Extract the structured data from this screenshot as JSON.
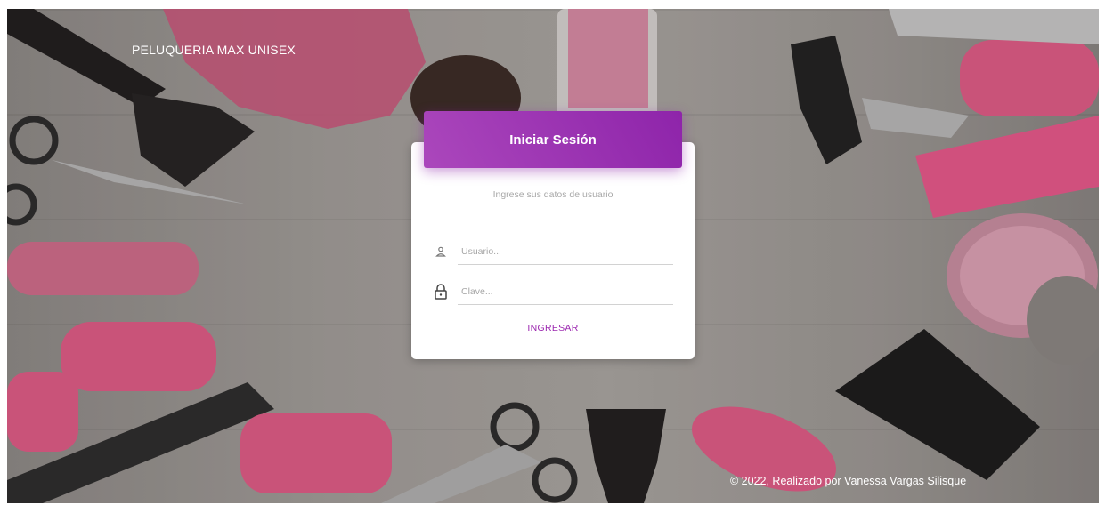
{
  "brand": {
    "title": "PELUQUERIA MAX UNISEX"
  },
  "login": {
    "title": "Iniciar Sesión",
    "subtitle": "Ingrese sus datos de usuario",
    "username": {
      "placeholder": "Usuario...",
      "icon": "user-icon"
    },
    "password": {
      "placeholder": "Clave...",
      "icon": "lock-icon"
    },
    "submit_label": "INGRESAR"
  },
  "footer": {
    "text": "© 2022, Realizado por Vanessa Vargas Silisque"
  },
  "colors": {
    "accent": "#9c27b0",
    "header_gradient": [
      "#ab47bc",
      "#8e24aa"
    ],
    "card": "#ffffff"
  }
}
